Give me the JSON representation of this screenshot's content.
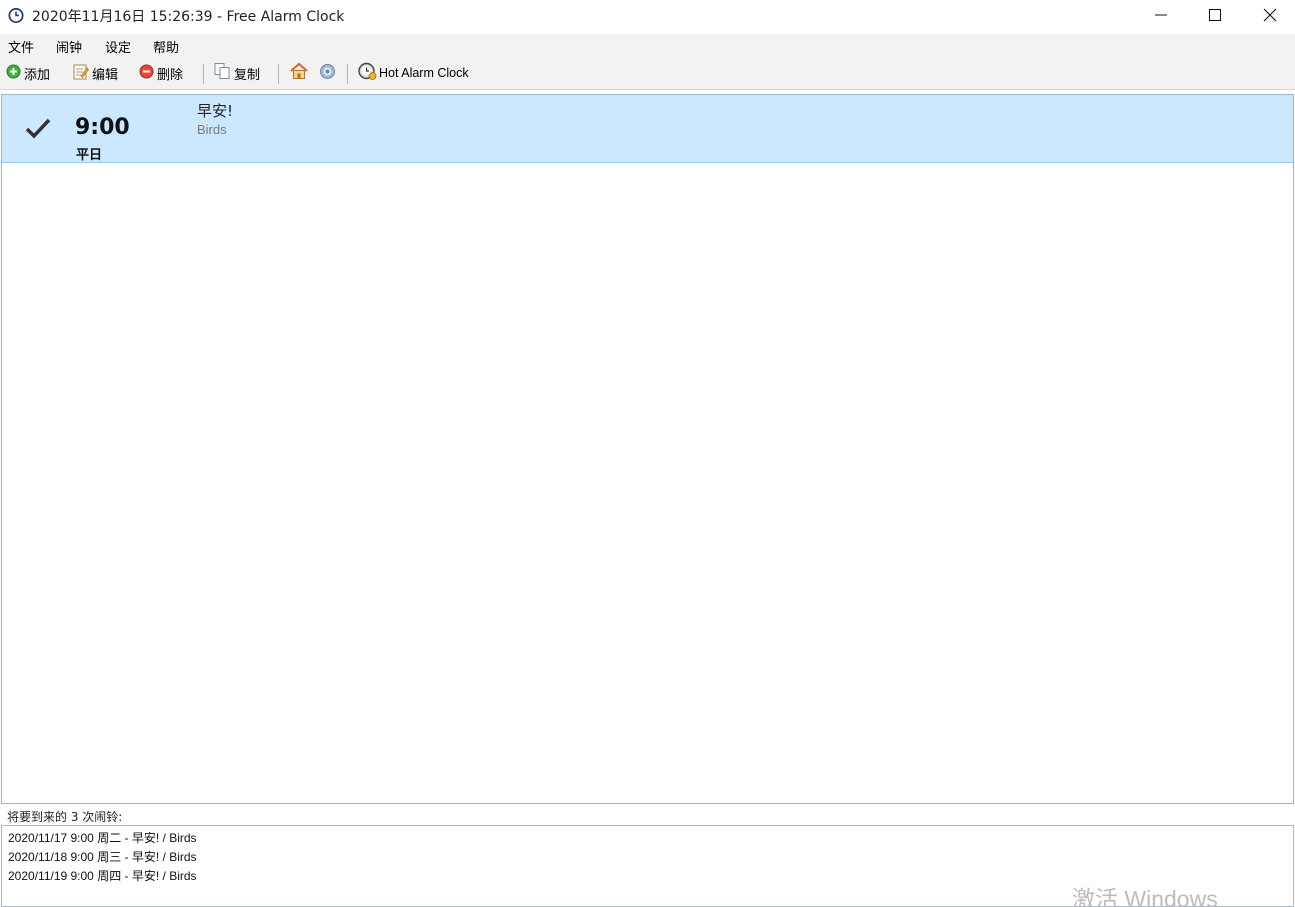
{
  "window": {
    "title": "2020年11月16日 15:26:39 - Free Alarm Clock"
  },
  "menu": {
    "items": [
      "文件",
      "闹钟",
      "设定",
      "帮助"
    ]
  },
  "toolbar": {
    "add_label": "添加",
    "edit_label": "编辑",
    "delete_label": "删除",
    "copy_label": "复制",
    "hot_alarm_label": "Hot Alarm Clock"
  },
  "alarms": [
    {
      "enabled": true,
      "time": "9:00",
      "days": "平日",
      "label": "早安!",
      "sound": "Birds"
    }
  ],
  "upcoming": {
    "header": "将要到来的 3 次闹铃:",
    "lines": [
      "2020/11/17 9:00 周二 - 早安! / Birds",
      "2020/11/18 9:00 周三 - 早安! / Birds",
      "2020/11/19 9:00 周四 - 早安! / Birds"
    ]
  },
  "watermark": "激活 Windows",
  "colors": {
    "selection": "#cce8ff",
    "selection_border": "#99c9ef",
    "chrome": "#f2f2f2"
  }
}
